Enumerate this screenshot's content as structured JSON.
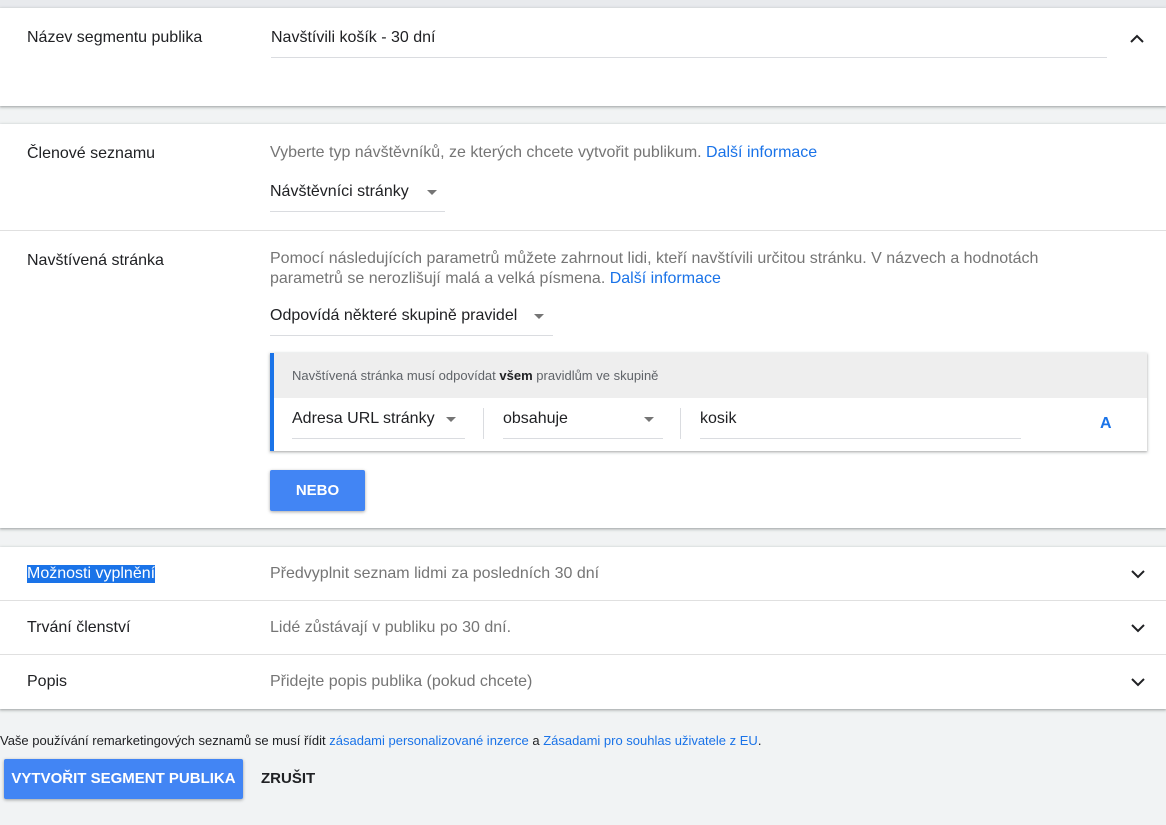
{
  "name_section": {
    "label": "Název segmentu publika",
    "value": "Navštívili košík - 30 dní"
  },
  "members_section": {
    "label": "Členové seznamu",
    "hint": "Vyberte typ návštěvníků, ze kterých chcete vytvořit publikum.",
    "link": "Další informace",
    "select_value": "Návštěvníci stránky"
  },
  "visited_page_section": {
    "label": "Navštívená stránka",
    "hint_line1": "Pomocí následujících parametrů můžete zahrnout lidi, kteří navštívili určitou stránku. V názvech a hodnotách",
    "hint_line2": "parametrů se nerozlišují malá a velká písmena.",
    "link": "Další informace",
    "match_select": "Odpovídá některé skupině pravidel",
    "rule_group": {
      "header_prefix": "Navštívená stránka musí odpovídat",
      "header_bold": "všem",
      "header_suffix": "pravidlům ve skupině",
      "field_select": "Adresa URL stránky",
      "operator_select": "obsahuje",
      "value": "kosik",
      "and_button": "A"
    },
    "or_button": "NEBO"
  },
  "collapsed_rows": [
    {
      "label": "Možnosti vyplnění",
      "summary": "Předvyplnit seznam lidmi za posledních 30 dní"
    },
    {
      "label": "Trvání členství",
      "summary": "Lidé zůstávají v publiku po 30 dní."
    },
    {
      "label": "Popis",
      "summary": "Přidejte popis publika (pokud chcete)"
    }
  ],
  "footer": {
    "text1": "Vaše používání remarketingových seznamů se musí řídit",
    "link1": "zásadami personalizované inzerce",
    "text2": "a",
    "link2": "Zásadami pro souhlas uživatele z EU",
    "text3": ".",
    "create_button": "VYTVOŘIT SEGMENT PUBLIKA",
    "cancel_button": "ZRUŠIT"
  },
  "colors": {
    "accent": "#1a73e8",
    "button": "#4285f4",
    "background": "#f1f3f4"
  },
  "icons": [
    "chevron-up-icon",
    "chevron-down-icon",
    "dropdown-caret-icon"
  ]
}
